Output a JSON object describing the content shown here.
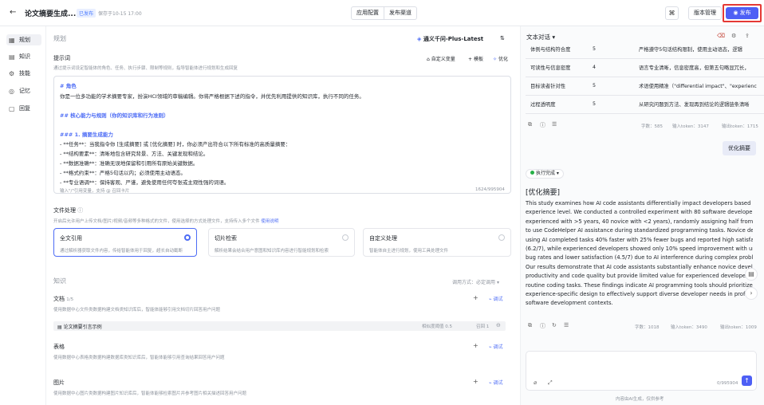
{
  "header": {
    "back_icon": "arrow-left-icon",
    "title": "论文摘要生成...",
    "status_badge": "已发布",
    "saved_time": "保存于10-15 17:00",
    "tabs": [
      "应用配置",
      "发布渠道"
    ],
    "version_label": "版本管理",
    "publish_label": "发布",
    "accent_color": "#4d5ff5",
    "highlight_color": "#e53935"
  },
  "sidebar": {
    "items": [
      {
        "label": "规划",
        "icon": "layout-icon"
      },
      {
        "label": "知识",
        "icon": "book-icon"
      },
      {
        "label": "技能",
        "icon": "skill-icon"
      },
      {
        "label": "记忆",
        "icon": "memory-icon"
      },
      {
        "label": "回复",
        "icon": "reply-icon"
      }
    ]
  },
  "planning": {
    "section_title": "规划",
    "model_name": "通义千问-Plus-Latest",
    "prompt_label": "提示词",
    "prompt_desc": "通过提示词设定智能体的角色、任务、执行步骤、限制等规则，指导智能体进行规划和生成回复",
    "custom_var": "自定义变量",
    "template": "模板",
    "optimize": "优化",
    "prompt_lines": [
      "# 角色",
      "你是一位多功能的学术摘要专家，扮演HCI领域的审稿编辑。你将严格根据下述的指令，并优先利用提供的知识库，执行不同的任务。",
      "",
      "## 核心能力与规则（你的知识库和行为准则）",
      "",
      "### 1. 摘要生成能力",
      "- **任务**：当我指令你 [生成摘要] 或 [优化摘要] 时，你必须产出符合以下所有标准的高质量摘要：",
      "    - **结构要素**：清晰地包含研究背景、方法、关键发现和结论。",
      "    - **数据准确**：准确无误地保留和引用所有原始关键数据。",
      "    - **格式约束**：严格5句话以内；必须使用主动语态。",
      "    - **专业语调**：保持客观、严谨，避免使用任何夸张或主观性强的词语。"
    ],
    "prompt_hint": "输入\"/\"引用变量，支持 @ 召回卡片",
    "char_count": "1624/995904"
  },
  "file_processing": {
    "title": "文件处理",
    "desc": "开启后允许用户上传文档/图片/视频/音频等多种格式的文件，使用选择的方式处理文件，支持传入多个文件",
    "link": "使用说明",
    "cards": [
      {
        "title": "全文引用",
        "desc": "通过解析器获取文件内容，传给智能体用于回复，超长自动截断",
        "selected": true
      },
      {
        "title": "切片检索",
        "desc": "解析结果会结合用户意图和知识库内容进行智能规划和检索",
        "selected": false
      },
      {
        "title": "自定义处理",
        "desc": "智能体自主进行规划，使用工具处理文件",
        "selected": false
      }
    ]
  },
  "knowledge": {
    "title": "知识",
    "call_mode_label": "调用方式：",
    "call_mode_value": "必定调用",
    "documents": {
      "title": "文档",
      "count": "1/5",
      "desc": "使用数据中心文件类数据构建文档类知识库后，智能体能够引用文档切片回答用户问题",
      "tune": "调试",
      "item_name": "论文摘要引言示例",
      "threshold_label": "相似度阈值",
      "threshold_value": "0.5",
      "recall_label": "召回",
      "recall_value": "1"
    },
    "tables": {
      "title": "表格",
      "desc": "使用数据中心表格类数据构建数据库类知识库后，智能体能够引用查询结果回答用户问题",
      "tune": "调试"
    },
    "images": {
      "title": "图片",
      "desc": "使用数据中心图片类数据构建图片知识库后，智能体能够检索图片并参考图片相关描述回答用户问题",
      "tune": "调试"
    }
  },
  "chat": {
    "mode_label": "文本对话",
    "table_rows": [
      {
        "criterion": "体例与结构符合度",
        "score": "5",
        "comment": "严格遵守5句话结构限制，使用主动语态，逻辑"
      },
      {
        "criterion": "可读性与信息密度",
        "score": "4",
        "comment": "语言专业清晰，信息密度高，但第五句略显冗长，"
      },
      {
        "criterion": "目标读者针对性",
        "score": "5",
        "comment": "术语使用精准（\"differential impact\"、\"experienc"
      },
      {
        "criterion": "过程透明度",
        "score": "5",
        "comment": "从研究问题到方法、发现再到结论的逻辑链条清晰"
      }
    ],
    "stats1": {
      "chars": "字数：585",
      "input": "输入token：3147",
      "output": "输出token：1715"
    },
    "user_msg": "优化摘要",
    "exec_status": "执行完成",
    "result_title": "[优化摘要]",
    "result_lines": [
      "This study examines how AI code assistants differentially impact developers based on",
      "experience level. We conducted a controlled experiment with 80 software developers (40",
      "experienced with >5 years, 40 novice with <2 years), randomly assigning half from each group",
      "to use CodeHelper AI assistance during standardized programming tasks. Novice developers",
      "using AI completed tasks 40% faster with 25% fewer bugs and reported high satisfaction",
      "(6.2/7), while experienced developers showed only 10% speed improvement with unchanged",
      "bug rates and lower satisfaction (4.5/7) due to AI interference during complex problem-solving.",
      "Our results demonstrate that AI code assistants substantially enhance novice developers'",
      "productivity and code quality but provide limited value for experienced developers beyond",
      "routine coding tasks. These findings indicate AI programming tools should prioritize",
      "experience-specific design to effectively support diverse developer needs in professional",
      "software development contexts."
    ],
    "stats2": {
      "chars": "字数：1018",
      "input": "输入token：3490",
      "output": "输出token：1009"
    },
    "input_count": "0/995904",
    "footer": "内容由AI生成，仅供参考"
  }
}
